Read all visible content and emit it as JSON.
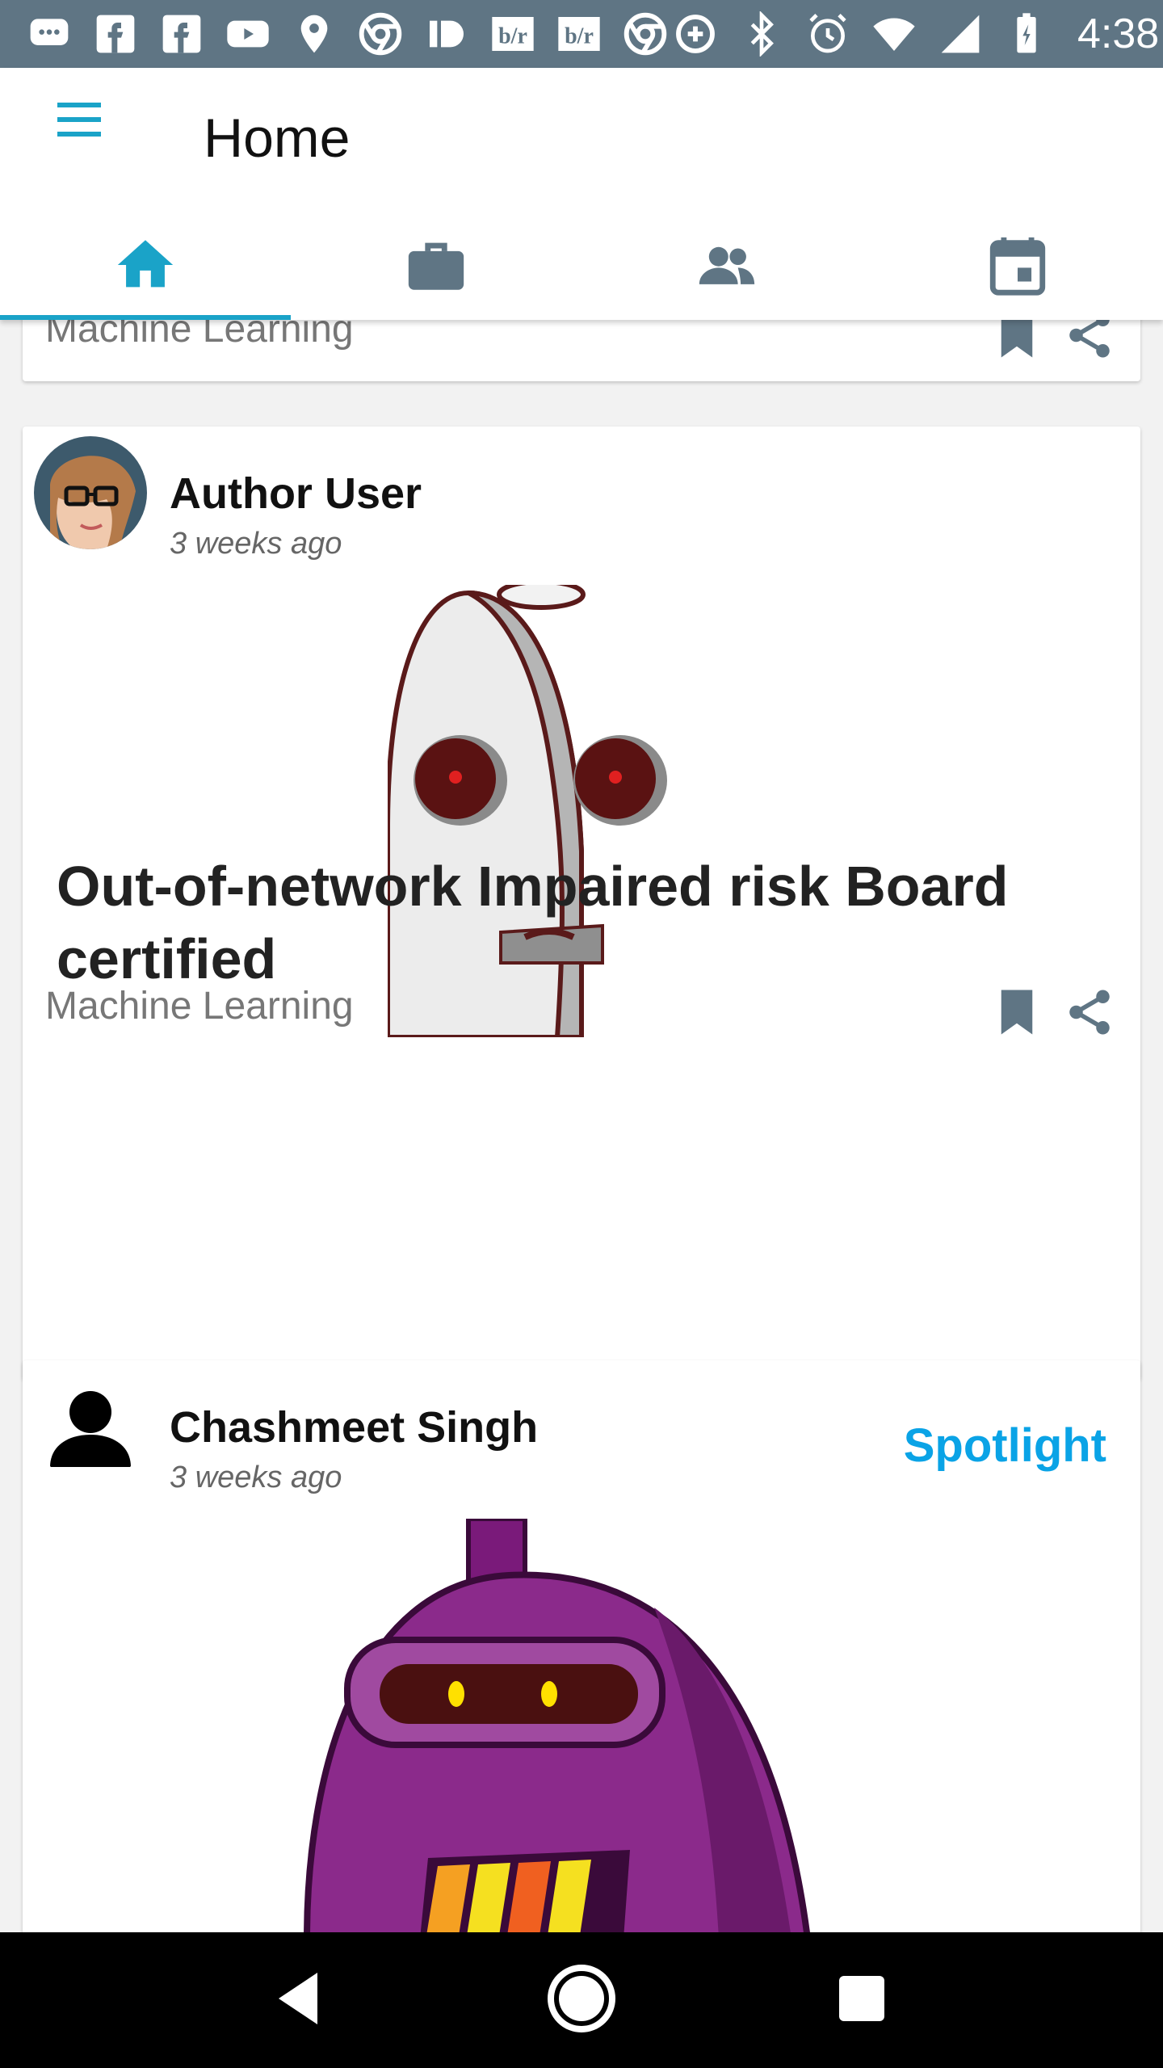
{
  "status_bar": {
    "time": "4:38",
    "icons_left": [
      "message-icon",
      "facebook-icon",
      "facebook-icon",
      "youtube-icon",
      "location-icon",
      "chrome-icon",
      "id-icon",
      "br-icon",
      "br-icon",
      "chrome-icon"
    ],
    "icons_right": [
      "data-saver-icon",
      "bluetooth-icon",
      "alarm-icon",
      "wifi-icon",
      "signal-icon",
      "battery-icon"
    ]
  },
  "header": {
    "title": "Home",
    "tabs": [
      "home-icon",
      "briefcase-icon",
      "people-icon",
      "calendar-icon"
    ],
    "active_tab": 0,
    "accent": "#1aa3c8"
  },
  "partial_card": {
    "category": "Machine Learning"
  },
  "post_a": {
    "author": "Author User",
    "time": "3 weeks ago",
    "title": "Out-of-network Impaired risk Board certified",
    "category": "Machine Learning"
  },
  "post_b": {
    "author": "Chashmeet Singh",
    "time": "3 weeks ago",
    "badge": "Spotlight",
    "badge_color": "#0aa3e6"
  }
}
